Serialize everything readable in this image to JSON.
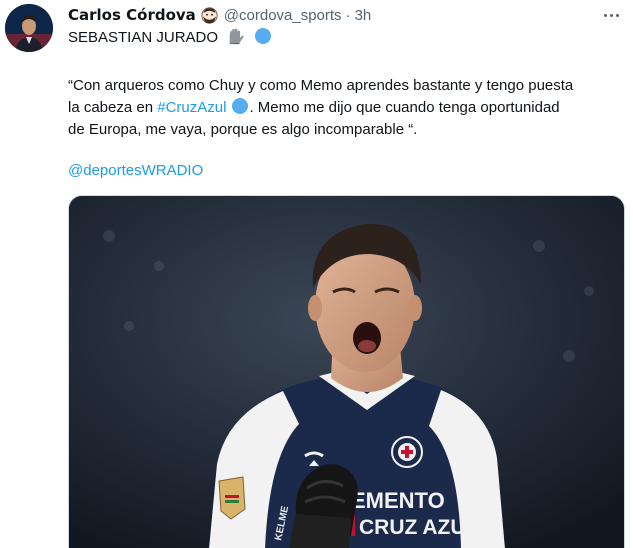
{
  "tweet": {
    "author": {
      "display_name": "Carlos Córdova",
      "handle": "@cordova_sports",
      "separator": "·",
      "time": "3h",
      "name_emoji": "bearded-face-emoji"
    },
    "text": {
      "headline": "SEBASTIAN JURADO",
      "line1": "“Con arqueros como Chuy y como Memo aprendes bastante y tengo puesta",
      "line2_prefix": "la cabeza en ",
      "hashtag": "#CruzAzul",
      "line2_suffix": ". Memo me dijo que cuando tenga oportunidad",
      "line3": "de Europa, me vaya, porque es algo incomparable “.",
      "mention": "@deportesWRADIO"
    },
    "media": {
      "jersey_text_1": "EMENTO",
      "jersey_text_2": "CRUZ AZUL",
      "jersey_colors": {
        "navy": "#1b2a4a",
        "white": "#f2f2f2",
        "red": "#c8102e"
      }
    },
    "icons": [
      "gloves-icon",
      "blue-circle-icon",
      "more-icon"
    ],
    "colors": {
      "link": "#1d9bf0",
      "secondary": "#536471",
      "text": "#0f1419"
    }
  }
}
